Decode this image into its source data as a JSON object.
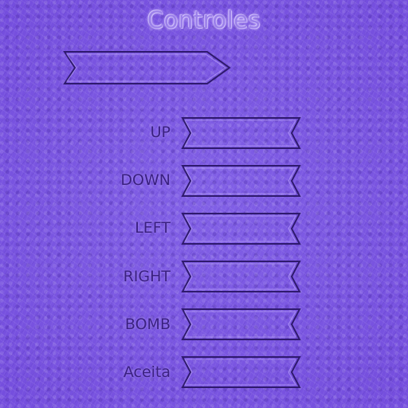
{
  "title": "Controles",
  "controls": [
    {
      "label": "UP"
    },
    {
      "label": "DOWN"
    },
    {
      "label": "LEFT"
    },
    {
      "label": "RIGHT"
    },
    {
      "label": "BOMB"
    },
    {
      "label": "Aceita"
    }
  ],
  "colors": {
    "background": "#7a55e0",
    "title": "#9b80ea",
    "label": "#3a2080",
    "outline": "#2f1a6e"
  }
}
